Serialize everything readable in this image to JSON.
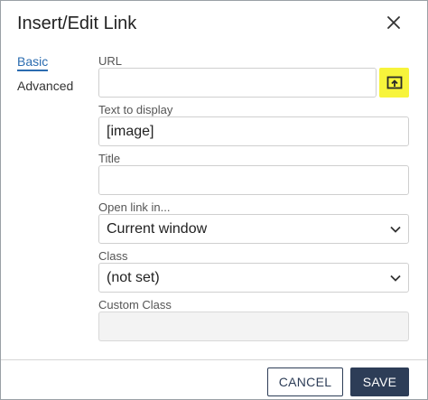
{
  "dialog": {
    "title": "Insert/Edit Link"
  },
  "nav": {
    "basic": "Basic",
    "advanced": "Advanced"
  },
  "form": {
    "url": {
      "label": "URL",
      "value": ""
    },
    "text_to_display": {
      "label": "Text to display",
      "value": "[image]"
    },
    "title": {
      "label": "Title",
      "value": ""
    },
    "open_link_in": {
      "label": "Open link in...",
      "selected": "Current window"
    },
    "class": {
      "label": "Class",
      "selected": "(not set)"
    },
    "custom_class": {
      "label": "Custom Class",
      "value": ""
    }
  },
  "footer": {
    "cancel": "CANCEL",
    "save": "SAVE"
  },
  "colors": {
    "accent": "#2b6cb0",
    "primary_button": "#2d3d57",
    "highlight": "#f7f43b"
  },
  "icons": {
    "close": "close-icon",
    "browse": "browse-upload-icon",
    "dropdown": "chevron-down-icon"
  }
}
